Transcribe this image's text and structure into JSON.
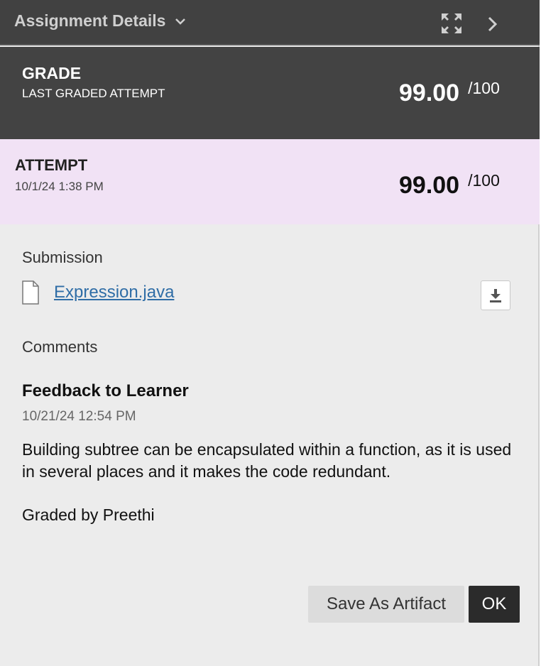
{
  "header": {
    "title": "Assignment Details",
    "icons": [
      "chevron-down-icon",
      "expand-icon",
      "chevron-right-icon"
    ]
  },
  "grade": {
    "label": "GRADE",
    "sublabel": "LAST GRADED ATTEMPT",
    "score": "99.00",
    "max": "/100"
  },
  "attempt": {
    "label": "ATTEMPT",
    "date": "10/1/24 1:38 PM",
    "score": "99.00",
    "max": "/100",
    "background_color": "#f1e2f5"
  },
  "submission": {
    "heading": "Submission",
    "file_name": "Expression.java",
    "icons": [
      "file-icon",
      "download-icon"
    ]
  },
  "comments": {
    "heading": "Comments",
    "feedback_title": "Feedback to Learner",
    "feedback_date": "10/21/24 12:54 PM",
    "feedback_body": "Building subtree can be encapsulated within a function, as it is used in several places and it makes the code redundant.",
    "graded_by": "Graded by Preethi"
  },
  "actions": {
    "save_artifact_label": "Save As Artifact",
    "ok_label": "OK"
  },
  "colors": {
    "header_bg": "#414141",
    "grade_bg": "#434343",
    "link": "#2f6da6",
    "panel_bg": "#ececec"
  }
}
